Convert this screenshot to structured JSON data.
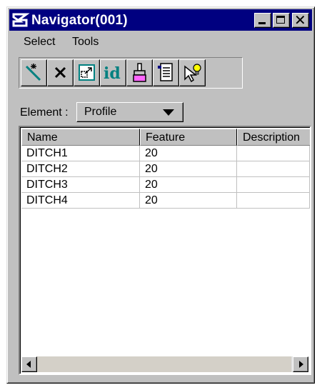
{
  "window": {
    "title": "Navigator(001)"
  },
  "menu": {
    "items": [
      "Select",
      "Tools"
    ]
  },
  "toolbar": {
    "icons": [
      "magic-select-icon",
      "delete-x-icon",
      "zoom-window-icon",
      "id-icon",
      "paint-brush-icon",
      "report-document-icon",
      "pointer-lightbulb-icon"
    ]
  },
  "element": {
    "label": "Element :",
    "value": "Profile"
  },
  "table": {
    "columns": [
      "Name",
      "Feature",
      "Description"
    ],
    "rows": [
      {
        "name": "DITCH1",
        "feature": "20",
        "description": ""
      },
      {
        "name": "DITCH2",
        "feature": "20",
        "description": ""
      },
      {
        "name": "DITCH3",
        "feature": "20",
        "description": ""
      },
      {
        "name": "DITCH4",
        "feature": "20",
        "description": ""
      }
    ]
  },
  "colors": {
    "titlebar": "#000080",
    "face": "#c0c0c0"
  }
}
